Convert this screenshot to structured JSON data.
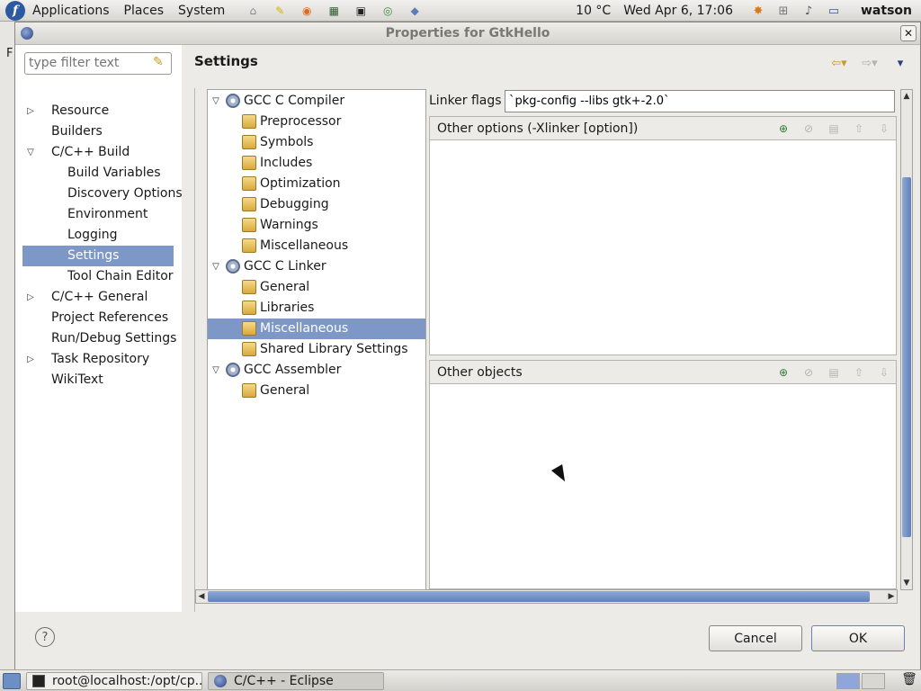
{
  "panel": {
    "menus": [
      "Applications",
      "Places",
      "System"
    ],
    "weather": "10 °C",
    "clock": "Wed Apr  6, 17:06",
    "user": "watson",
    "launcher_icons": [
      "network-icon",
      "notes-icon",
      "firefox-icon",
      "system-monitor-icon",
      "terminal-icon",
      "chrome-icon",
      "cube-icon"
    ],
    "tray_icons": [
      "update-icon",
      "network-manager-icon",
      "volume-icon",
      "display-icon"
    ]
  },
  "dialog": {
    "title": "Properties for GtkHello",
    "filter_placeholder": "type filter text",
    "nav": [
      {
        "label": "Resource",
        "expander": "▷",
        "indent": 0
      },
      {
        "label": "Builders",
        "expander": "",
        "indent": 0
      },
      {
        "label": "C/C++ Build",
        "expander": "▽",
        "indent": 0
      },
      {
        "label": "Build Variables",
        "expander": "",
        "indent": 1
      },
      {
        "label": "Discovery Options",
        "expander": "",
        "indent": 1
      },
      {
        "label": "Environment",
        "expander": "",
        "indent": 1
      },
      {
        "label": "Logging",
        "expander": "",
        "indent": 1
      },
      {
        "label": "Settings",
        "expander": "",
        "indent": 1,
        "selected": true
      },
      {
        "label": "Tool Chain Editor",
        "expander": "",
        "indent": 1
      },
      {
        "label": "C/C++ General",
        "expander": "▷",
        "indent": 0
      },
      {
        "label": "Project References",
        "expander": "",
        "indent": 0
      },
      {
        "label": "Run/Debug Settings",
        "expander": "",
        "indent": 0
      },
      {
        "label": "Task Repository",
        "expander": "▷",
        "indent": 0
      },
      {
        "label": "WikiText",
        "expander": "",
        "indent": 0
      }
    ],
    "heading": "Settings",
    "tool_tree": [
      {
        "label": "GCC C Compiler",
        "expander": "▽",
        "icon": "gear",
        "indent": 0
      },
      {
        "label": "Preprocessor",
        "icon": "folder",
        "indent": 1
      },
      {
        "label": "Symbols",
        "icon": "folder",
        "indent": 1
      },
      {
        "label": "Includes",
        "icon": "folder",
        "indent": 1
      },
      {
        "label": "Optimization",
        "icon": "folder",
        "indent": 1
      },
      {
        "label": "Debugging",
        "icon": "folder",
        "indent": 1
      },
      {
        "label": "Warnings",
        "icon": "folder",
        "indent": 1
      },
      {
        "label": "Miscellaneous",
        "icon": "folder",
        "indent": 1
      },
      {
        "label": "GCC C Linker",
        "expander": "▽",
        "icon": "gear",
        "indent": 0
      },
      {
        "label": "General",
        "icon": "folder",
        "indent": 1
      },
      {
        "label": "Libraries",
        "icon": "folder",
        "indent": 1
      },
      {
        "label": "Miscellaneous",
        "icon": "folder",
        "indent": 1,
        "selected": true
      },
      {
        "label": "Shared Library Settings",
        "icon": "folder",
        "indent": 1
      },
      {
        "label": "GCC Assembler",
        "expander": "▽",
        "icon": "gear",
        "indent": 0
      },
      {
        "label": "General",
        "icon": "folder",
        "indent": 1
      }
    ],
    "linker_flags_label": "Linker flags",
    "linker_flags_value": "`pkg-config --libs gtk+-2.0`",
    "group_other_options": "Other options (-Xlinker [option])",
    "group_other_objects": "Other objects",
    "cancel_label": "Cancel",
    "ok_label": "OK",
    "help_symbol": "?"
  },
  "taskbar": {
    "tasks": [
      {
        "label": "root@localhost:/opt/cp...",
        "icon": "terminal"
      },
      {
        "label": "C/C++ - Eclipse",
        "icon": "eclipse",
        "active": true
      }
    ]
  }
}
